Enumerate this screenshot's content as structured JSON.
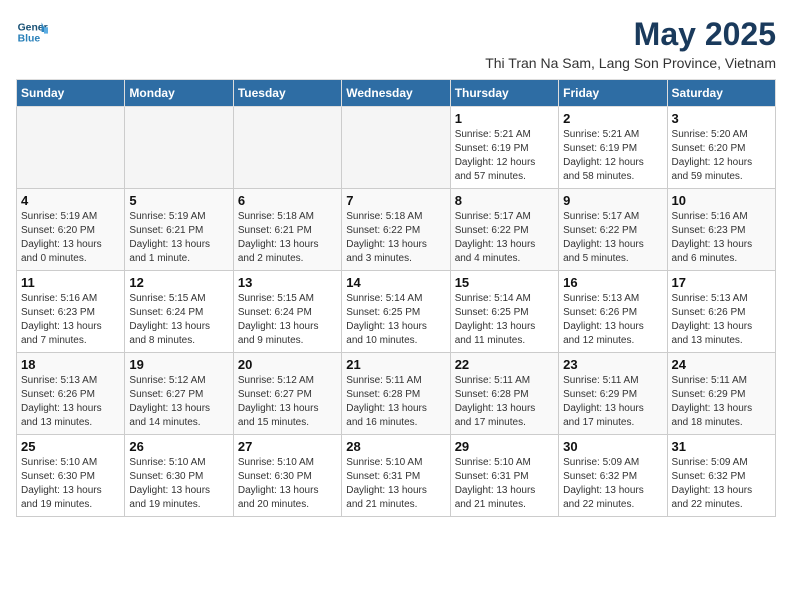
{
  "header": {
    "logo_line1": "General",
    "logo_line2": "Blue",
    "month_title": "May 2025",
    "location": "Thi Tran Na Sam, Lang Son Province, Vietnam"
  },
  "weekdays": [
    "Sunday",
    "Monday",
    "Tuesday",
    "Wednesday",
    "Thursday",
    "Friday",
    "Saturday"
  ],
  "weeks": [
    [
      {
        "day": "",
        "info": ""
      },
      {
        "day": "",
        "info": ""
      },
      {
        "day": "",
        "info": ""
      },
      {
        "day": "",
        "info": ""
      },
      {
        "day": "1",
        "info": "Sunrise: 5:21 AM\nSunset: 6:19 PM\nDaylight: 12 hours\nand 57 minutes."
      },
      {
        "day": "2",
        "info": "Sunrise: 5:21 AM\nSunset: 6:19 PM\nDaylight: 12 hours\nand 58 minutes."
      },
      {
        "day": "3",
        "info": "Sunrise: 5:20 AM\nSunset: 6:20 PM\nDaylight: 12 hours\nand 59 minutes."
      }
    ],
    [
      {
        "day": "4",
        "info": "Sunrise: 5:19 AM\nSunset: 6:20 PM\nDaylight: 13 hours\nand 0 minutes."
      },
      {
        "day": "5",
        "info": "Sunrise: 5:19 AM\nSunset: 6:21 PM\nDaylight: 13 hours\nand 1 minute."
      },
      {
        "day": "6",
        "info": "Sunrise: 5:18 AM\nSunset: 6:21 PM\nDaylight: 13 hours\nand 2 minutes."
      },
      {
        "day": "7",
        "info": "Sunrise: 5:18 AM\nSunset: 6:22 PM\nDaylight: 13 hours\nand 3 minutes."
      },
      {
        "day": "8",
        "info": "Sunrise: 5:17 AM\nSunset: 6:22 PM\nDaylight: 13 hours\nand 4 minutes."
      },
      {
        "day": "9",
        "info": "Sunrise: 5:17 AM\nSunset: 6:22 PM\nDaylight: 13 hours\nand 5 minutes."
      },
      {
        "day": "10",
        "info": "Sunrise: 5:16 AM\nSunset: 6:23 PM\nDaylight: 13 hours\nand 6 minutes."
      }
    ],
    [
      {
        "day": "11",
        "info": "Sunrise: 5:16 AM\nSunset: 6:23 PM\nDaylight: 13 hours\nand 7 minutes."
      },
      {
        "day": "12",
        "info": "Sunrise: 5:15 AM\nSunset: 6:24 PM\nDaylight: 13 hours\nand 8 minutes."
      },
      {
        "day": "13",
        "info": "Sunrise: 5:15 AM\nSunset: 6:24 PM\nDaylight: 13 hours\nand 9 minutes."
      },
      {
        "day": "14",
        "info": "Sunrise: 5:14 AM\nSunset: 6:25 PM\nDaylight: 13 hours\nand 10 minutes."
      },
      {
        "day": "15",
        "info": "Sunrise: 5:14 AM\nSunset: 6:25 PM\nDaylight: 13 hours\nand 11 minutes."
      },
      {
        "day": "16",
        "info": "Sunrise: 5:13 AM\nSunset: 6:26 PM\nDaylight: 13 hours\nand 12 minutes."
      },
      {
        "day": "17",
        "info": "Sunrise: 5:13 AM\nSunset: 6:26 PM\nDaylight: 13 hours\nand 13 minutes."
      }
    ],
    [
      {
        "day": "18",
        "info": "Sunrise: 5:13 AM\nSunset: 6:26 PM\nDaylight: 13 hours\nand 13 minutes."
      },
      {
        "day": "19",
        "info": "Sunrise: 5:12 AM\nSunset: 6:27 PM\nDaylight: 13 hours\nand 14 minutes."
      },
      {
        "day": "20",
        "info": "Sunrise: 5:12 AM\nSunset: 6:27 PM\nDaylight: 13 hours\nand 15 minutes."
      },
      {
        "day": "21",
        "info": "Sunrise: 5:11 AM\nSunset: 6:28 PM\nDaylight: 13 hours\nand 16 minutes."
      },
      {
        "day": "22",
        "info": "Sunrise: 5:11 AM\nSunset: 6:28 PM\nDaylight: 13 hours\nand 17 minutes."
      },
      {
        "day": "23",
        "info": "Sunrise: 5:11 AM\nSunset: 6:29 PM\nDaylight: 13 hours\nand 17 minutes."
      },
      {
        "day": "24",
        "info": "Sunrise: 5:11 AM\nSunset: 6:29 PM\nDaylight: 13 hours\nand 18 minutes."
      }
    ],
    [
      {
        "day": "25",
        "info": "Sunrise: 5:10 AM\nSunset: 6:30 PM\nDaylight: 13 hours\nand 19 minutes."
      },
      {
        "day": "26",
        "info": "Sunrise: 5:10 AM\nSunset: 6:30 PM\nDaylight: 13 hours\nand 19 minutes."
      },
      {
        "day": "27",
        "info": "Sunrise: 5:10 AM\nSunset: 6:30 PM\nDaylight: 13 hours\nand 20 minutes."
      },
      {
        "day": "28",
        "info": "Sunrise: 5:10 AM\nSunset: 6:31 PM\nDaylight: 13 hours\nand 21 minutes."
      },
      {
        "day": "29",
        "info": "Sunrise: 5:10 AM\nSunset: 6:31 PM\nDaylight: 13 hours\nand 21 minutes."
      },
      {
        "day": "30",
        "info": "Sunrise: 5:09 AM\nSunset: 6:32 PM\nDaylight: 13 hours\nand 22 minutes."
      },
      {
        "day": "31",
        "info": "Sunrise: 5:09 AM\nSunset: 6:32 PM\nDaylight: 13 hours\nand 22 minutes."
      }
    ]
  ]
}
